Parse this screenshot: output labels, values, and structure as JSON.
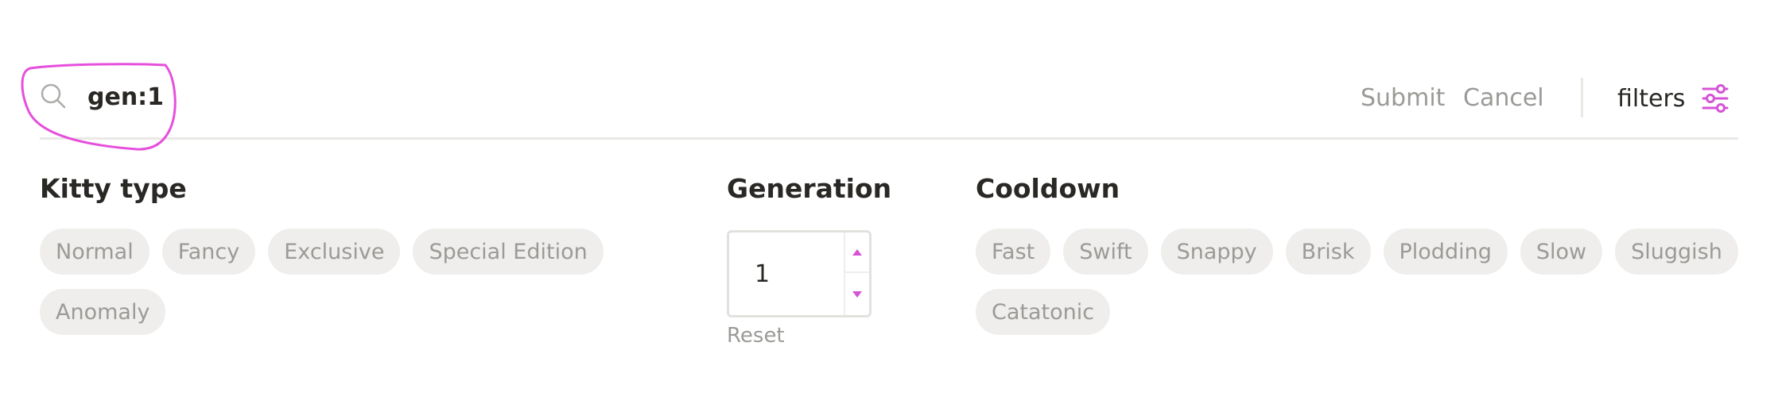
{
  "search": {
    "value": "gen:1",
    "icon": "search-icon",
    "highlight_color": "#e64fdc"
  },
  "actions": {
    "submit_label": "Submit",
    "cancel_label": "Cancel",
    "filters_label": "filters",
    "filters_icon": "sliders-icon"
  },
  "kitty_type": {
    "title": "Kitty type",
    "options": [
      "Normal",
      "Fancy",
      "Exclusive",
      "Special Edition",
      "Anomaly"
    ]
  },
  "generation": {
    "title": "Generation",
    "value": "1",
    "reset_label": "Reset"
  },
  "cooldown": {
    "title": "Cooldown",
    "options": [
      "Fast",
      "Swift",
      "Snappy",
      "Brisk",
      "Plodding",
      "Slow",
      "Sluggish",
      "Catatonic"
    ]
  },
  "colors": {
    "accent": "#d653d6",
    "chip_bg": "#efeeec",
    "chip_text": "#9c9a97",
    "text": "#2a2825"
  }
}
